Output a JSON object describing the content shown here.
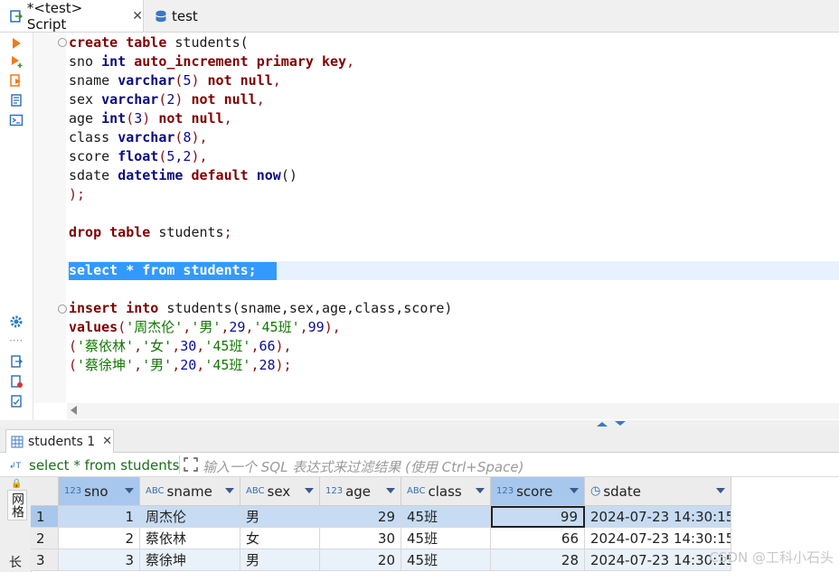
{
  "tabs": {
    "script_label": "*<test> Script",
    "test_label": "test"
  },
  "editor": {
    "lines": {
      "l1": {
        "kw": "create table",
        "rest": " students("
      },
      "l2": {
        "a": "sno ",
        "typ": "int",
        "kw": " auto_increment primary key",
        "pun": ","
      },
      "l3": {
        "a": "sname ",
        "typ": "varchar",
        "p1": "(",
        "n": "5",
        "p2": ")",
        "kw": " not null",
        "pun": ","
      },
      "l4": {
        "a": "sex ",
        "typ": "varchar",
        "p1": "(",
        "n": "2",
        "p2": ")",
        "kw": " not null",
        "pun": ","
      },
      "l5": {
        "a": "age ",
        "typ": "int",
        "p1": "(",
        "n": "3",
        "p2": ")",
        "kw": " not null",
        "pun": ","
      },
      "l6": {
        "a": "class ",
        "typ": "varchar",
        "p1": "(",
        "n": "8",
        "p2": ")",
        "pun": ","
      },
      "l7": {
        "a": "score ",
        "typ": "float",
        "p1": "(",
        "n": "5,2",
        "p2": ")",
        "pun": ","
      },
      "l8": {
        "a": "sdate ",
        "typ": "datetime",
        "kw": " default",
        "fn": " now",
        "p": "()"
      },
      "l9": {
        "pun": ");"
      },
      "l11": {
        "kw": "drop table",
        "rest": " students",
        "pun": ";"
      },
      "l13": {
        "text": "select * from students;"
      },
      "l15": {
        "kw": "insert into",
        "rest": " students(sname,sex,age,class,score)"
      },
      "l16": {
        "kw": "values",
        "p1": "(",
        "s1": "'周杰伦'",
        "c1": ",",
        "s2": "'男'",
        "c2": ",",
        "n": "29",
        "c3": ",",
        "s3": "'45班'",
        "c4": ",",
        "n2": "99",
        "p2": "),"
      },
      "l17": {
        "p1": "(",
        "s1": "'蔡依林'",
        "c1": ",",
        "s2": "'女'",
        "c2": ",",
        "n": "30",
        "c3": ",",
        "s3": "'45班'",
        "c4": ",",
        "n2": "66",
        "p2": "),"
      },
      "l18": {
        "p1": "(",
        "s1": "'蔡徐坤'",
        "c1": ",",
        "s2": "'男'",
        "c2": ",",
        "n": "20",
        "c3": ",",
        "s3": "'45班'",
        "c4": ",",
        "n2": "28",
        "p2": ");"
      }
    }
  },
  "results": {
    "tab_label": "students 1",
    "query": "select * from students",
    "filter_placeholder": "输入一个 SQL 表达式来过滤结果 (使用 Ctrl+Space)",
    "side_label": "网格",
    "columns": [
      {
        "type": "123",
        "name": "sno"
      },
      {
        "type": "ABC",
        "name": "sname"
      },
      {
        "type": "ABC",
        "name": "sex"
      },
      {
        "type": "123",
        "name": "age"
      },
      {
        "type": "ABC",
        "name": "class"
      },
      {
        "type": "123",
        "name": "score"
      },
      {
        "type": "◷",
        "name": "sdate"
      }
    ],
    "rows": [
      {
        "num": "1",
        "sno": "1",
        "sname": "周杰伦",
        "sex": "男",
        "age": "29",
        "class": "45班",
        "score": "99",
        "sdate": "2024-07-23 14:30:15"
      },
      {
        "num": "2",
        "sno": "2",
        "sname": "蔡依林",
        "sex": "女",
        "age": "30",
        "class": "45班",
        "score": "66",
        "sdate": "2024-07-23 14:30:15"
      },
      {
        "num": "3",
        "sno": "3",
        "sname": "蔡徐坤",
        "sex": "男",
        "age": "20",
        "class": "45班",
        "score": "28",
        "sdate": "2024-07-23 14:30:15"
      }
    ]
  },
  "watermark": "CSDN @工科小石头",
  "colors": {
    "selection": "#3399ff",
    "row_selected": "#c7dcf3",
    "header_selected": "#a7c8ec"
  }
}
